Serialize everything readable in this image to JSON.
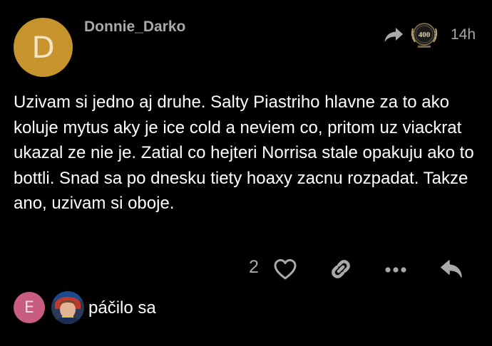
{
  "post": {
    "avatar_letter": "D",
    "avatar_color": "#c6932c",
    "username": "Donnie_Darko",
    "badge_text": "400",
    "time": "14h",
    "body": "Uzivam si jedno aj druhe. Salty Piastriho hlavne za to ako koluje mytus aky je ice cold a neviem co, pritom uz viackrat ukazal ze nie je. Zatial co hejteri Norrisa stale opakuju ako to bottli. Snad sa po dnesku tiety hoaxy zacnu rozpadat. Takze ano, uzivam si oboje."
  },
  "actions": {
    "like_count": "2",
    "icons": [
      "heart-icon",
      "link-icon",
      "more-icon",
      "reply-icon"
    ]
  },
  "likers": {
    "first_letter": "E",
    "first_color": "#c85c82",
    "label": "páčilo sa"
  }
}
